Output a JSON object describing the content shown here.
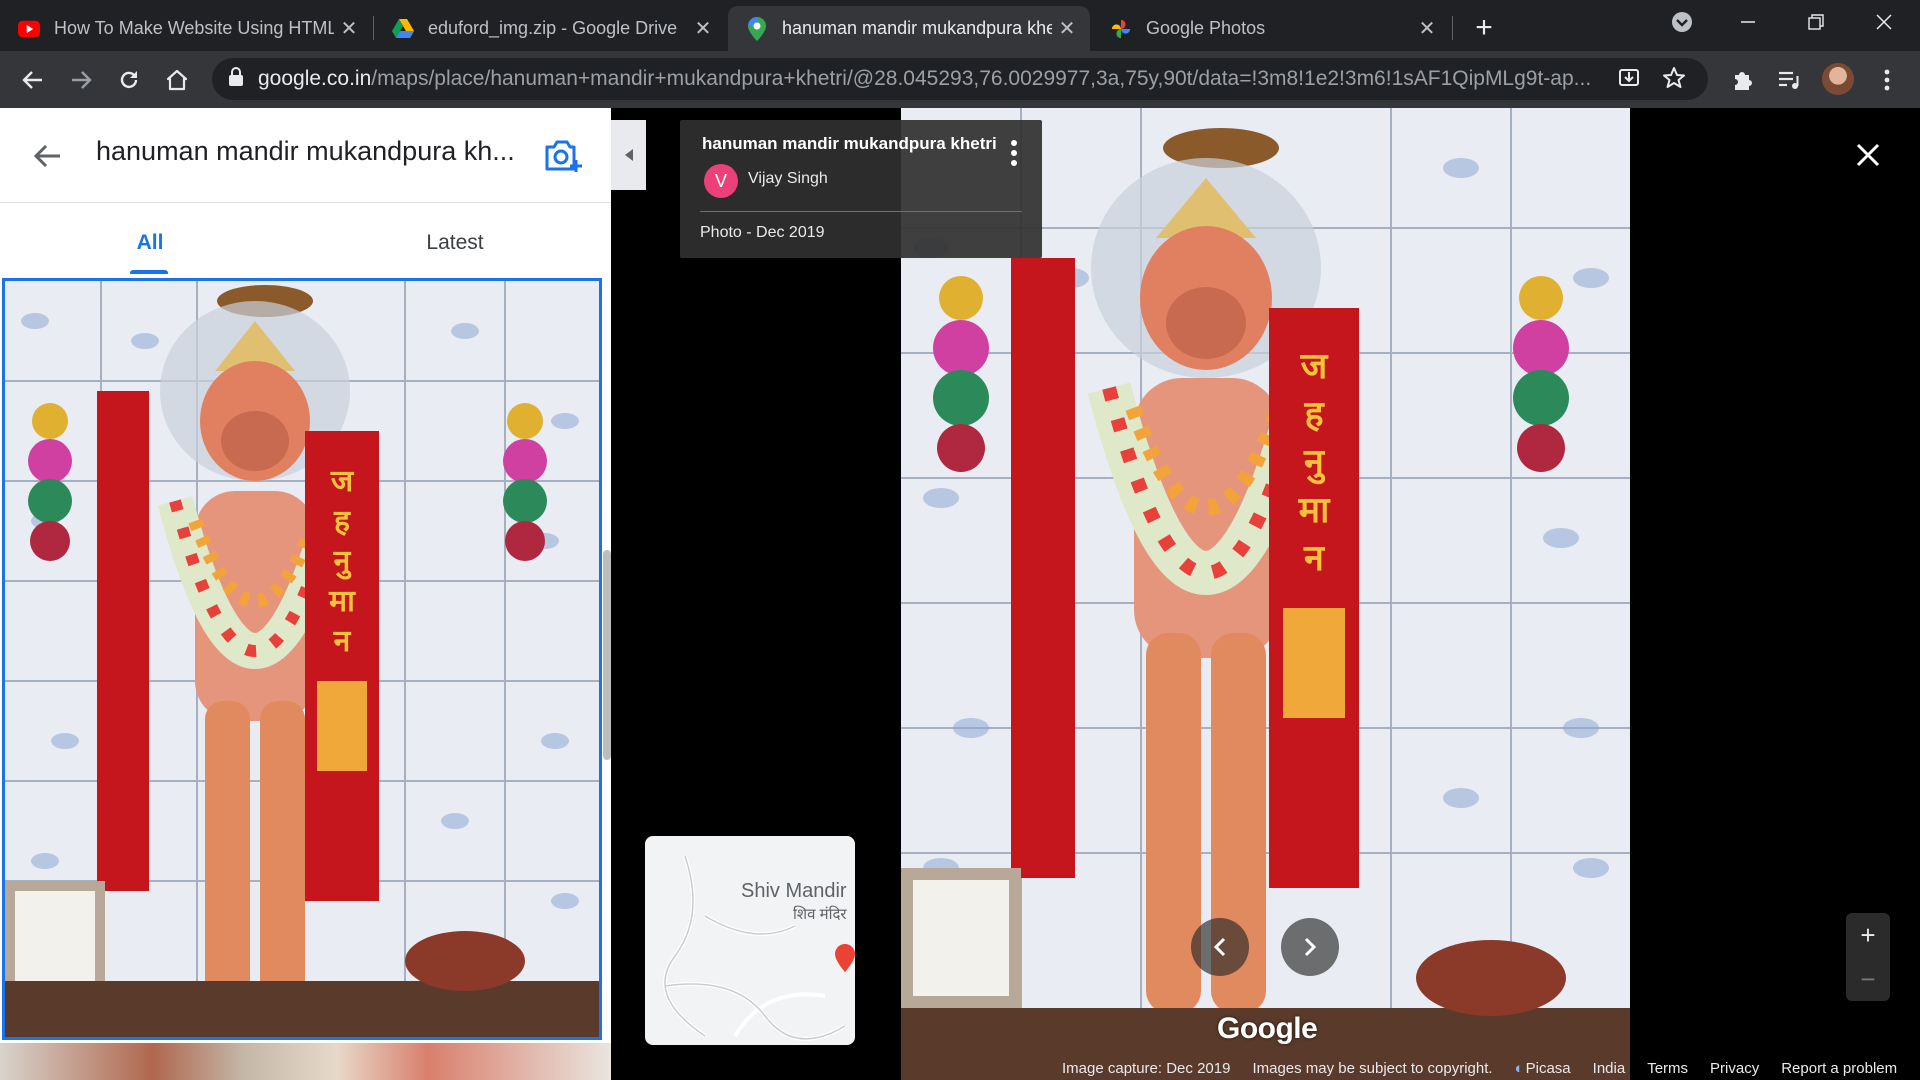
{
  "browser": {
    "tabs": [
      {
        "title": "How To Make Website Using HTML",
        "icon": "youtube-icon",
        "active": false
      },
      {
        "title": "eduford_img.zip - Google Drive",
        "icon": "google-drive-icon",
        "active": false
      },
      {
        "title": "hanuman mandir mukandpura khetri",
        "icon": "google-maps-icon",
        "active": true
      },
      {
        "title": "Google Photos",
        "icon": "google-photos-icon",
        "active": false
      }
    ],
    "url_host": "google.co.in",
    "url_path": "/maps/place/hanuman+mandir+mukandpura+khetri/@28.045293,76.0029977,3a,75y,90t/data=!3m8!1e2!3m6!1sAF1QipMLg9t-ap..."
  },
  "panel": {
    "title": "hanuman mandir mukandpura kh...",
    "tabs": [
      "All",
      "Latest"
    ]
  },
  "infocard": {
    "title": "hanuman mandir mukandpura khetri",
    "avatar_letter": "V",
    "author": "Vijay Singh",
    "date": "Photo - Dec 2019"
  },
  "minimap": {
    "label": "Shiv Mandir",
    "label_sub": "शिव मंदिर"
  },
  "viewer": {
    "watermark": "Google",
    "banner_text": "जय हनुमान"
  },
  "zoom": {
    "in": "+",
    "out": "−"
  },
  "footer": {
    "image_capture": "Image capture: Dec 2019",
    "copyright": "Images may be subject to copyright.",
    "picasa": "Picasa",
    "country": "India",
    "terms": "Terms",
    "privacy": "Privacy",
    "report": "Report a problem"
  },
  "colors": {
    "accent": "#1a73e8",
    "avatar": "#ec407a",
    "chrome_dark": "#202124",
    "chrome_toolbar": "#35363a"
  }
}
